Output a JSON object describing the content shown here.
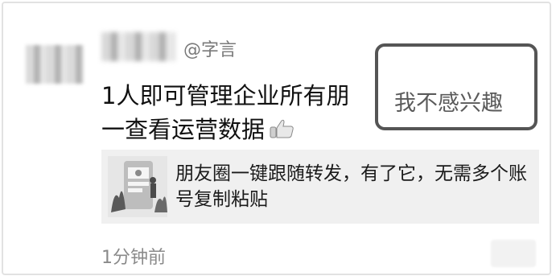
{
  "post": {
    "handle": "@字言",
    "text": "1人即可管理企业所有朋友圈，一查看运营数据",
    "text_line1": "1人即可管理企业所有朋",
    "text_line2": "一查看运营数据"
  },
  "menu": {
    "not_interested_label": "我不感兴趣"
  },
  "link_card": {
    "title": "朋友圈一键跟随转发，有了它，无需多个账号复制粘贴"
  },
  "footer": {
    "time_ago": "1分钟前"
  },
  "icons": {
    "thumb": "thumbs-up-emoji-icon",
    "chevron": "chevron-down-icon"
  },
  "colors": {
    "highlight_border": "#555555",
    "menu_text": "#5a5a5a",
    "card_bg": "#f0f0f0",
    "secondary_text": "#8a8a8a"
  }
}
